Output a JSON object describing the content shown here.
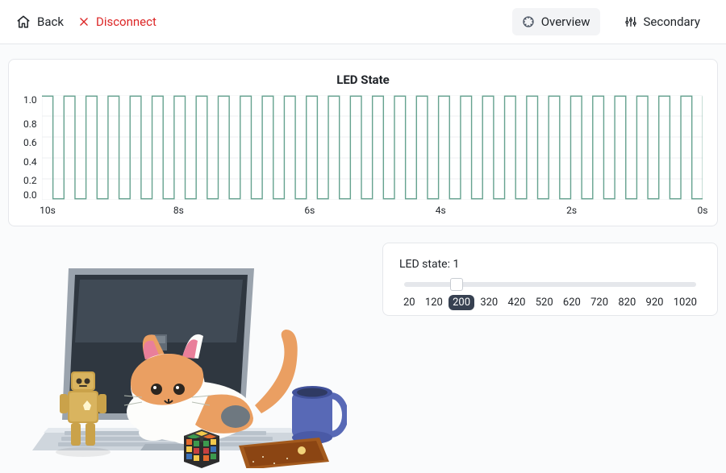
{
  "topbar": {
    "back_label": "Back",
    "disconnect_label": "Disconnect",
    "tab_overview": "Overview",
    "tab_secondary": "Secondary"
  },
  "chart_data": {
    "type": "line",
    "title": "LED State",
    "xlabel": "",
    "ylabel": "",
    "ylim": [
      0,
      1
    ],
    "y_ticks": [
      "1.0",
      "0.8",
      "0.6",
      "0.4",
      "0.2",
      "0.0"
    ],
    "x_ticks": [
      {
        "label": "10s",
        "pos": 0.0
      },
      {
        "label": "8s",
        "pos": 0.2
      },
      {
        "label": "6s",
        "pos": 0.4
      },
      {
        "label": "4s",
        "pos": 0.6
      },
      {
        "label": "2s",
        "pos": 0.8
      },
      {
        "label": "0s",
        "pos": 1.0
      }
    ],
    "signal": {
      "period_seconds": 0.333,
      "duty_cycle": 0.5,
      "low": 0,
      "high": 1,
      "window_seconds": 10,
      "cycles_visible": 30
    }
  },
  "slider": {
    "label_prefix": "LED state: ",
    "current_value": 1,
    "selected_mark": 200,
    "min": 20,
    "max": 1020,
    "marks": [
      20,
      120,
      200,
      320,
      420,
      520,
      620,
      720,
      820,
      920,
      1020
    ]
  },
  "colors": {
    "chart_line": "#65a28f",
    "chart_grid": "#eceff2",
    "accent_dark": "#374151",
    "error": "#dc2626"
  }
}
